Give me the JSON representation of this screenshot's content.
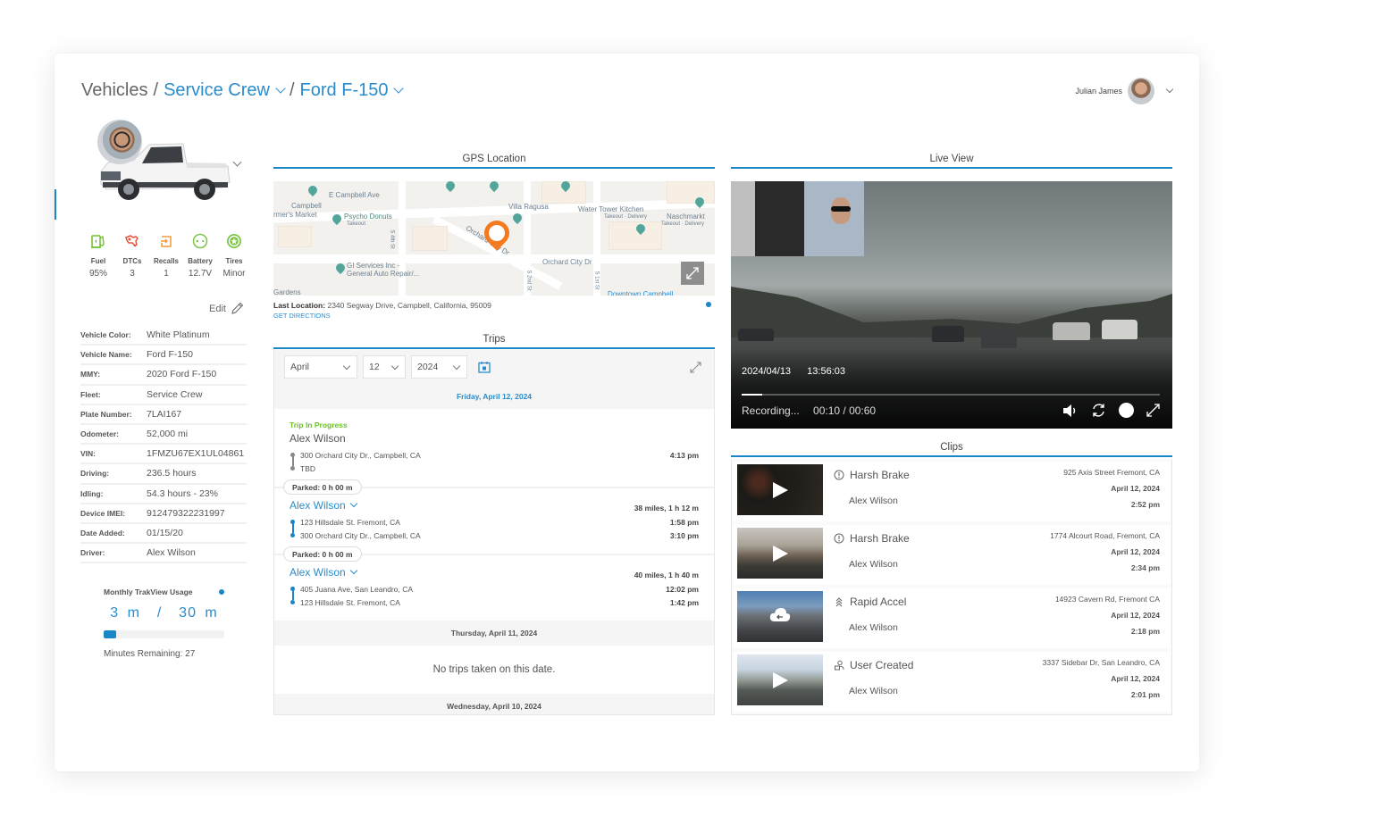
{
  "breadcrumb": {
    "root": "Vehicles",
    "separator": "/",
    "fleet": "Service Crew",
    "vehicle": "Ford F-150"
  },
  "user": {
    "name": "Julian James"
  },
  "colors": {
    "accent": "#1a85c7",
    "link": "#2a8ccc",
    "fuel": "#6cc027",
    "dtcs": "#e2553b",
    "recalls": "#f39a3b",
    "battery": "#7cc64a",
    "tires": "#7cc64a",
    "trip_in_progress": "#6cc027",
    "map_pin": "#f37a1f"
  },
  "stats": [
    {
      "icon": "fuel-pump-icon",
      "label": "Fuel",
      "value": "95%"
    },
    {
      "icon": "engine-warning-icon",
      "label": "DTCs",
      "value": "3"
    },
    {
      "icon": "recall-icon",
      "label": "Recalls",
      "value": "1"
    },
    {
      "icon": "battery-icon",
      "label": "Battery",
      "value": "12.7V"
    },
    {
      "icon": "tire-icon",
      "label": "Tires",
      "value": "Minor"
    }
  ],
  "edit_label": "Edit",
  "details": [
    {
      "label": "Vehicle Color:",
      "value": "White Platinum"
    },
    {
      "label": "Vehicle Name:",
      "value": "Ford F-150"
    },
    {
      "label": "MMY:",
      "value": "2020 Ford F-150"
    },
    {
      "label": "Fleet:",
      "value": "Service Crew"
    },
    {
      "label": "Plate Number:",
      "value": "7LAI167"
    },
    {
      "label": "Odometer:",
      "value": "52,000 mi"
    },
    {
      "label": "VIN:",
      "value": "1FMZU67EX1UL04861"
    },
    {
      "label": "Driving:",
      "value": "236.5 hours"
    },
    {
      "label": "Idling:",
      "value": "54.3 hours - 23%"
    },
    {
      "label": "Device IMEI:",
      "value": "912479322231997"
    },
    {
      "label": "Date Added:",
      "value": "01/15/20"
    },
    {
      "label": "Driver:",
      "value": "Alex Wilson"
    }
  ],
  "usage": {
    "title": "Monthly TrakView Usage",
    "display": "3 m  /  30 m",
    "used_minutes": 3,
    "total_minutes": 30,
    "progress_fraction": 0.1,
    "remaining": "Minutes Remaining: 27"
  },
  "gps": {
    "title": "GPS Location",
    "last_location_label": "Last Location:",
    "last_location": "2340 Segway Drive, Campbell, California, 95009",
    "directions": "GET DIRECTIONS",
    "map_labels": {
      "street1": "E Campbell Ave",
      "poi1": "Campbell",
      "poi1b": "rmer's Market",
      "poi2": "Psycho Donuts",
      "poi2_sub": "Takeout",
      "poi3": "Villa Ragusa",
      "poi4": "Water Tower Kitchen",
      "poi4_sub": "Takeout · Delivery",
      "poi5": "Naschmarkt",
      "poi5_sub": "Takeout · Delivery",
      "street2": "Orchard City Dr",
      "street3": "Orchard City Dr",
      "street4": "S 4th St",
      "street5": "S 2nd St",
      "street6": "S 1st St",
      "poi6": "GI Services Inc -",
      "poi6b": "General Auto Repair/...",
      "poi7": "Gardens",
      "poi8": "Downtown Campbell"
    }
  },
  "trips": {
    "title": "Trips",
    "filters": {
      "month": "April",
      "day": "12",
      "year": "2024"
    },
    "days": [
      {
        "header": "Friday, April 12, 2024",
        "trips": [
          {
            "status": "Trip In Progress",
            "driver": "Alex Wilson",
            "summary": "",
            "from": "300 Orchard City Dr., Campbell, CA",
            "from_time": "4:13 pm",
            "to": "TBD",
            "to_time": "",
            "parked": "Parked: 0 h 00 m"
          },
          {
            "status": "",
            "driver": "Alex Wilson",
            "summary": "38 miles, 1 h 12 m",
            "from": "123 Hillsdale St. Fremont, CA",
            "from_time": "1:58 pm",
            "to": "300 Orchard City Dr., Campbell, CA",
            "to_time": "3:10 pm",
            "parked": "Parked: 0 h 00 m"
          },
          {
            "status": "",
            "driver": "Alex Wilson",
            "summary": "40 miles, 1 h 40 m",
            "from": "405 Juana Ave, San Leandro, CA",
            "from_time": "12:02 pm",
            "to": "123 Hillsdale St. Fremont, CA",
            "to_time": "1:42 pm",
            "parked": ""
          }
        ]
      },
      {
        "header": "Thursday, April 11, 2024",
        "empty": "No trips taken on this date."
      },
      {
        "header": "Wednesday, April 10, 2024"
      }
    ]
  },
  "live": {
    "title": "Live View",
    "timestamp": "2024/04/13  13:56:03",
    "status": "Recording...",
    "time": "00:10 / 00:60",
    "elapsed_seconds": 10,
    "total_seconds": 60,
    "progress_fraction": 0.05
  },
  "clips": {
    "title": "Clips",
    "items": [
      {
        "icon": "alert-circle-icon",
        "event": "Harsh Brake",
        "driver": "Alex Wilson",
        "address": "925 Axis Street Fremont, CA",
        "date": "April 12, 2024",
        "time": "2:52 pm",
        "thumb_action": "play"
      },
      {
        "icon": "alert-circle-icon",
        "event": "Harsh Brake",
        "driver": "Alex Wilson",
        "address": "1774 Alcourt Road, Fremont, CA",
        "date": "April 12, 2024",
        "time": "2:34 pm",
        "thumb_action": "play"
      },
      {
        "icon": "rapid-accel-icon",
        "event": "Rapid Accel",
        "driver": "Alex Wilson",
        "address": "14923 Cavern Rd, Fremont CA",
        "date": "April 12, 2024",
        "time": "2:18 pm",
        "thumb_action": "download"
      },
      {
        "icon": "user-created-icon",
        "event": "User Created",
        "driver": "Alex Wilson",
        "address": "3337 Sidebar Dr, San Leandro, CA",
        "date": "April 12, 2024",
        "time": "2:01 pm",
        "thumb_action": "play"
      }
    ]
  }
}
